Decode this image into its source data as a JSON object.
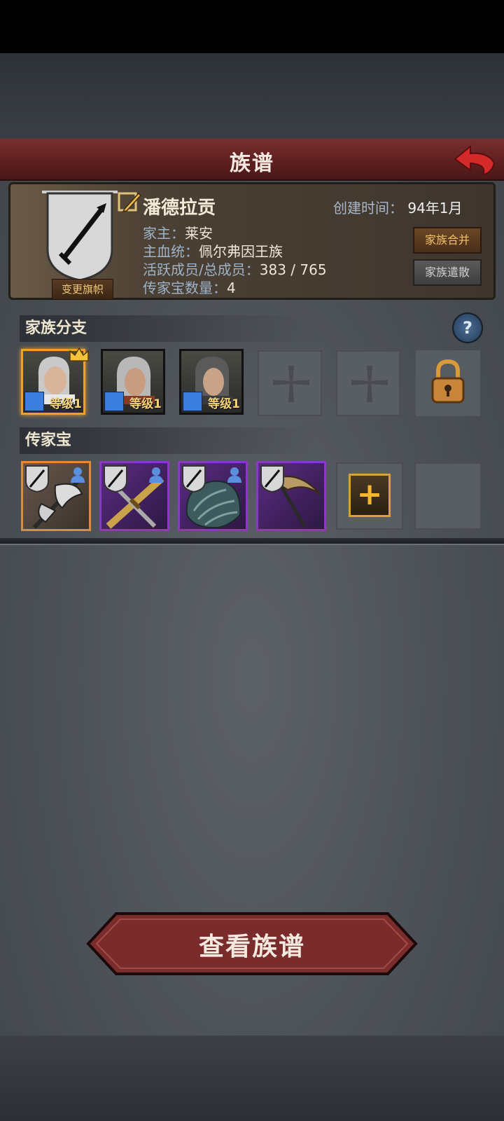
{
  "title": "族谱",
  "family": {
    "banner_button": "变更旗帜",
    "name": "潘德拉贡",
    "create_time_label": "创建时间：",
    "create_time_value": "94年1月",
    "head_label": "家主：",
    "head_value": "莱安",
    "bloodline_label": "主血统：",
    "bloodline_value": "佩尔弗因王族",
    "members_label": "活跃成员/总成员：",
    "members_value": "383 / 765",
    "heirloom_count_label": "传家宝数量：",
    "heirloom_count_value": "4",
    "merge_button": "家族合并",
    "disband_button": "家族遣散"
  },
  "branches": {
    "header": "家族分支",
    "heroes": [
      {
        "level": "等级1",
        "leader": true
      },
      {
        "level": "等级1",
        "leader": false
      },
      {
        "level": "等级1",
        "leader": false
      }
    ]
  },
  "heirlooms": {
    "header": "传家宝",
    "items": [
      {
        "rarity": "orange",
        "icon": "halberd-icon"
      },
      {
        "rarity": "purple",
        "icon": "crossed-swords-icon"
      },
      {
        "rarity": "purple",
        "icon": "fur-cloak-icon"
      },
      {
        "rarity": "purple",
        "icon": "scythe-icon"
      }
    ],
    "add_symbol": "+"
  },
  "view_button": "查看族谱",
  "colors": {
    "accent_red": "#6b2323",
    "gold": "#f0a02a",
    "purple": "#8b38c8"
  }
}
